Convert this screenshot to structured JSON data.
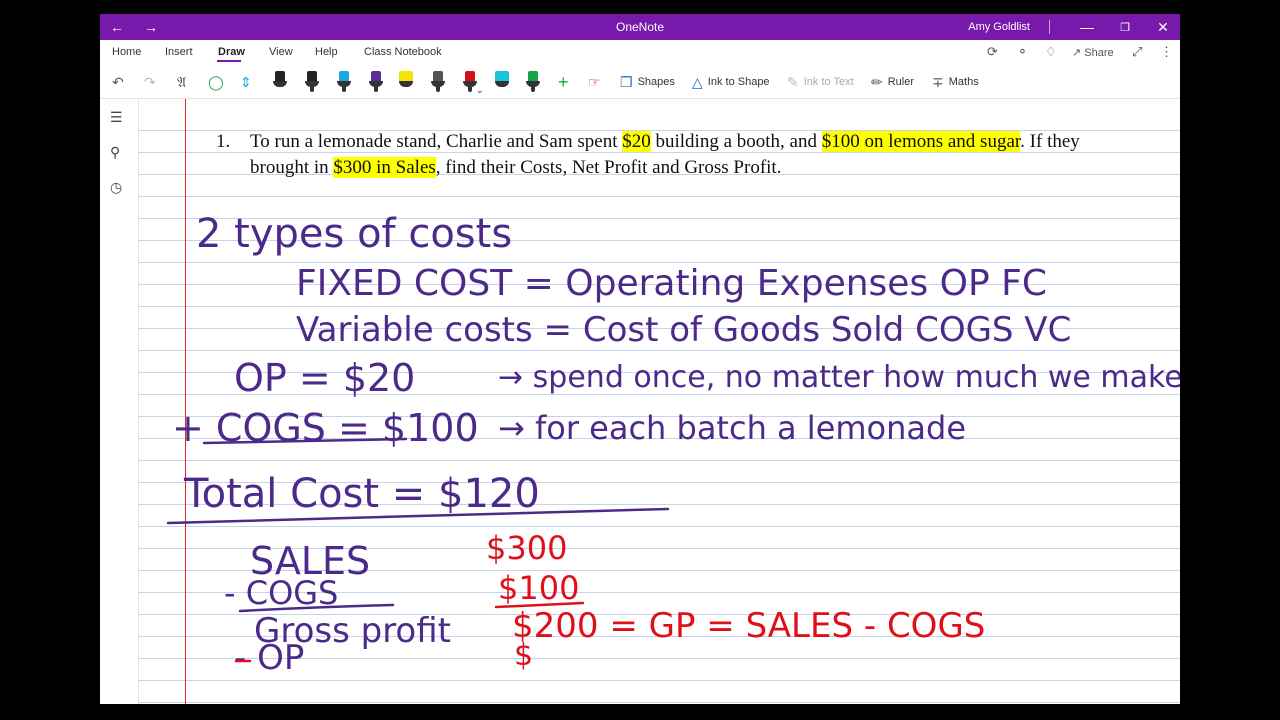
{
  "window": {
    "app_title": "OneNote",
    "user": "Amy Goldlist"
  },
  "tabs": [
    "Home",
    "Insert",
    "Draw",
    "View",
    "Help",
    "Class Notebook"
  ],
  "active_tab": "Draw",
  "toolbar": {
    "shapes_label": "Shapes",
    "ink_to_shape_label": "Ink to Shape",
    "ink_to_text_label": "Ink to Text",
    "ruler_label": "Ruler",
    "maths_label": "Maths",
    "share_label": "Share",
    "pen_colors": [
      "#222222",
      "#222222",
      "#1aa7e6",
      "#5b2d90",
      "#f5e400",
      "#222222",
      "#d0101a",
      "#1ac6d9",
      "#16a34a"
    ]
  },
  "problem": {
    "number": "1.",
    "parts": [
      {
        "t": "To run a lemonade stand, Charlie and Sam spent ",
        "hl": false
      },
      {
        "t": "$20",
        "hl": true
      },
      {
        "t": " building a booth, and ",
        "hl": false
      },
      {
        "t": "$100 on lemons and sugar",
        "hl": true
      },
      {
        "t": ".  If they brought in ",
        "hl": false
      },
      {
        "t": "$300 in Sales",
        "hl": true
      },
      {
        "t": ", find their Costs, Net Profit and Gross Profit.",
        "hl": false
      }
    ]
  },
  "ink": {
    "purple": "#4b2a8a",
    "red": "#e0101a",
    "line1": "2 types of costs",
    "line2": "FIXED COST = Operating Expenses  OP  FC",
    "line3": "Variable costs = Cost of Goods Sold  COGS  VC",
    "line4a": "OP = $20",
    "line4b": "→ spend once, no matter how much we make",
    "line5a": "+ COGS = $100",
    "line5b": "→ for each batch a lemonade",
    "line6": "Total Cost = $120",
    "sales_label": "SALES",
    "cogs_label": "- COGS",
    "gp_label": "Gross profit",
    "op_label": "- OP",
    "v300": "$300",
    "v100": "$100",
    "v200": "$200 = GP = SALES - COGS",
    "vdollar": "$"
  }
}
